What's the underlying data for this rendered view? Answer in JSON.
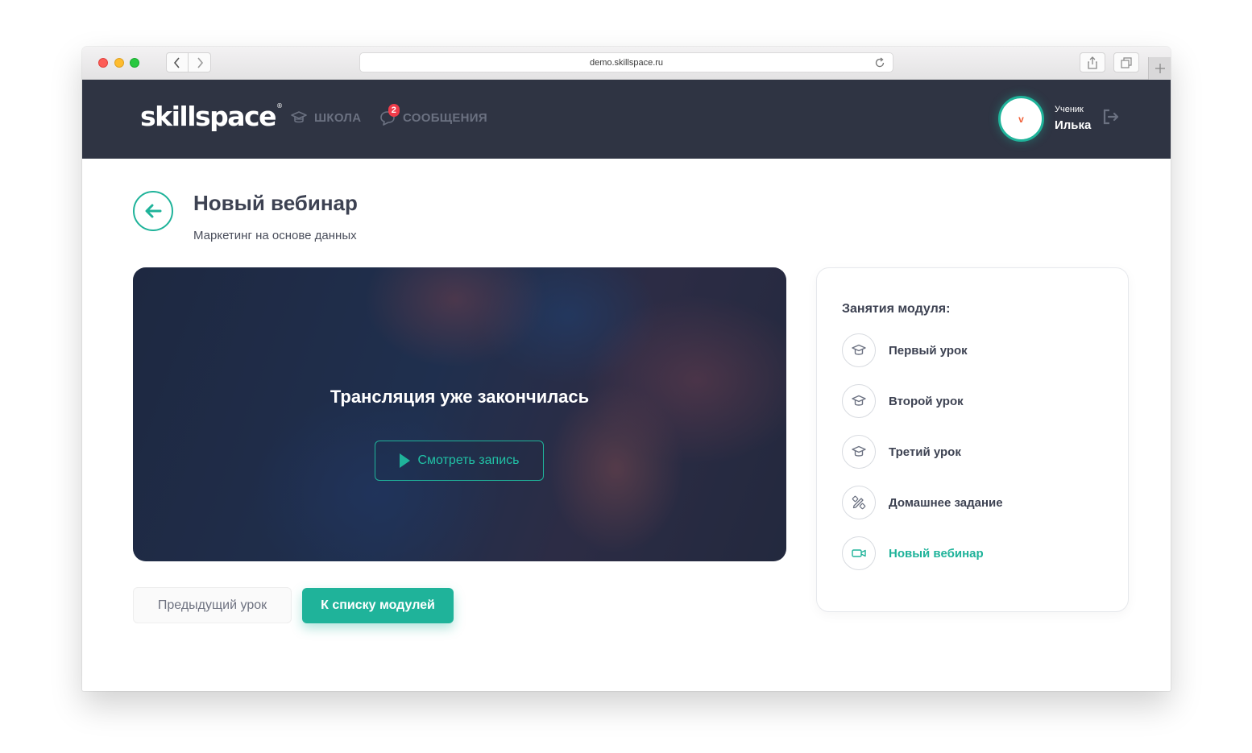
{
  "browser": {
    "url": "demo.skillspace.ru"
  },
  "header": {
    "logo_text": "skillspace",
    "logo_mark": "®",
    "nav": [
      {
        "label": "ШКОЛА",
        "icon": "graduation-cap-icon"
      },
      {
        "label": "СООБЩЕНИЯ",
        "icon": "chat-icon",
        "badge": "2"
      }
    ],
    "user": {
      "avatar_initial": "v",
      "role": "Ученик",
      "name": "Илька"
    }
  },
  "page": {
    "title": "Новый вебинар",
    "subtitle": "Маркетинг на основе данных"
  },
  "video": {
    "status_text": "Трансляция уже закончилась",
    "watch_label": "Смотреть запись"
  },
  "actions": {
    "prev_label": "Предыдущий урок",
    "modules_label": "К списку модулей"
  },
  "sidebar": {
    "title": "Занятия модуля:",
    "lessons": [
      {
        "label": "Первый урок",
        "icon": "graduation-cap-icon",
        "active": false
      },
      {
        "label": "Второй урок",
        "icon": "graduation-cap-icon",
        "active": false
      },
      {
        "label": "Третий урок",
        "icon": "graduation-cap-icon",
        "active": false
      },
      {
        "label": "Домашнее задание",
        "icon": "pencil-ruler-icon",
        "active": false
      },
      {
        "label": "Новый вебинар",
        "icon": "video-camera-icon",
        "active": true
      }
    ]
  },
  "colors": {
    "accent": "#1fb39a",
    "header_bg": "#2f3443",
    "badge": "#f03c4a",
    "avatar_initial": "#f0613a"
  }
}
